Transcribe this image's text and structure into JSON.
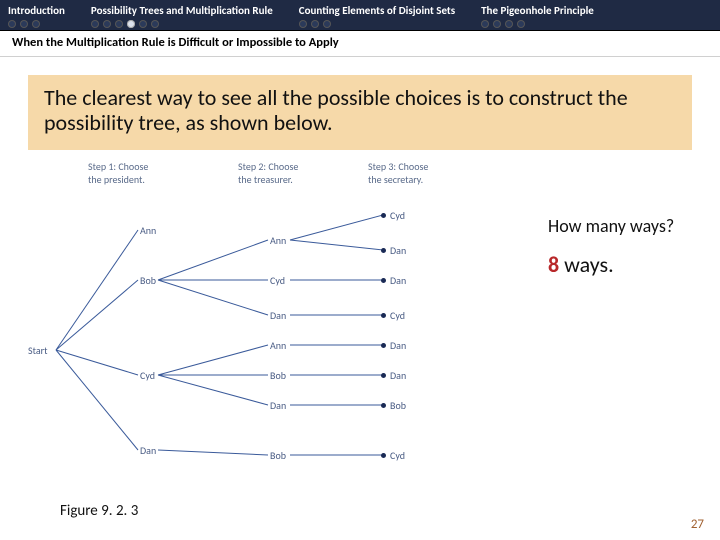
{
  "nav": {
    "sections": [
      {
        "title": "Introduction",
        "dots": 3,
        "current": -1
      },
      {
        "title": "Possibility Trees and Multiplication Rule",
        "dots": 6,
        "current": 3
      },
      {
        "title": "Counting Elements of Disjoint Sets",
        "dots": 3,
        "current": -1
      },
      {
        "title": "The Pigeonhole Principle",
        "dots": 4,
        "current": -1
      }
    ],
    "subtitle": "When the Multiplication Rule is Difficult or Impossible to Apply"
  },
  "body_text": "The clearest way to see all the possible choices is to construct the possibility tree, as shown below.",
  "tree": {
    "headers": {
      "step1": "Step 1: Choose\nthe president.",
      "step2": "Step 2: Choose\nthe treasurer.",
      "step3": "Step 3: Choose\nthe secretary."
    },
    "root": "Start",
    "level1": [
      "Ann",
      "Bob",
      "Cyd",
      "Dan"
    ],
    "subtree": {
      "Ann": [],
      "Bob": [
        {
          "mid": "Ann",
          "leaves": [
            "Cyd",
            "Dan"
          ]
        },
        {
          "mid": "Cyd",
          "leaves": [
            "Dan"
          ]
        },
        {
          "mid": "Dan",
          "leaves": [
            "Cyd"
          ]
        }
      ],
      "Cyd": [
        {
          "mid": "Ann",
          "leaves": [
            "Dan"
          ]
        },
        {
          "mid": "Bob",
          "leaves": [
            "Dan"
          ]
        },
        {
          "mid": "Dan",
          "leaves": [
            "Bob"
          ]
        }
      ],
      "Dan": [
        {
          "mid": "Bob",
          "leaves": [
            "Cyd"
          ]
        }
      ]
    }
  },
  "question": "How many ways?",
  "answer_num": "8",
  "answer_rest": " ways.",
  "figure_caption": "Figure 9. 2. 3",
  "page_number": "27"
}
